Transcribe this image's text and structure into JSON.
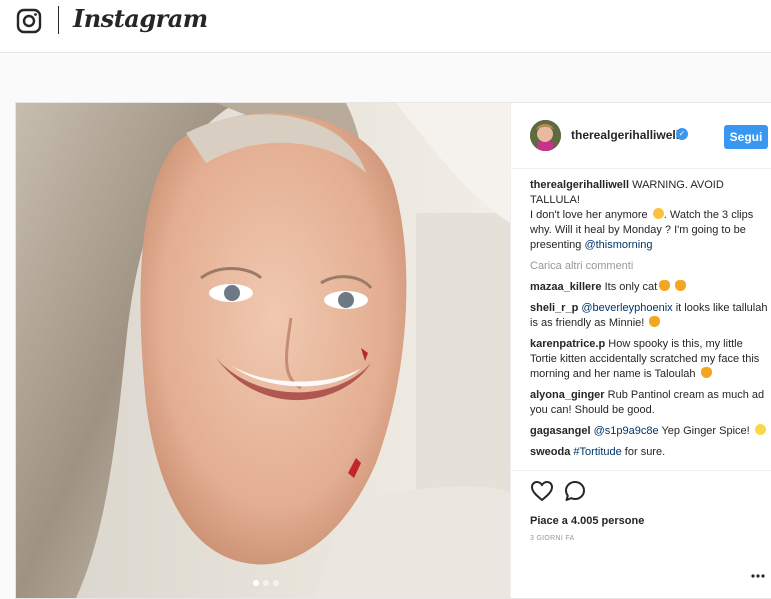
{
  "header": {
    "logo_text": "Instagram",
    "camera_icon": "instagram-camera-icon"
  },
  "post": {
    "author": "therealgerihalliwell",
    "verified_icon": "verified-badge-icon",
    "follow_label": "Segui",
    "caption": {
      "user": "therealgerihalliwell",
      "text_1": "WARNING. AVOID TALLULA!",
      "text_2": "I don't love her anymore",
      "text_3": ". Watch the 3 clips why. Will it heal by Monday ? I'm going to be presenting",
      "mention": "@thismorning"
    },
    "load_more": "Carica altri commenti",
    "comments": [
      {
        "user": "mazaa_killere",
        "text": "Its only cat",
        "mention": "",
        "after": ""
      },
      {
        "user": "sheli_r_p",
        "text": "",
        "mention": "@beverleyphoenix",
        "after": "it looks like tallulah is as friendly as Minnie!"
      },
      {
        "user": "karenpatrice.p",
        "text": "How spooky is this, my little Tortie kitten accidentally scratched my face this morning and her name is Taloulah",
        "mention": "",
        "after": ""
      },
      {
        "user": "alyona_ginger",
        "text": "Rub Pantinol cream as much ad you can! Should be good.",
        "mention": "",
        "after": ""
      },
      {
        "user": "gagasangel",
        "text": "",
        "mention": "@s1p9a9c8e",
        "after": "Yep Ginger Spice!"
      },
      {
        "user": "sweoda",
        "text": "",
        "mention": "#Tortitude",
        "after": "for sure."
      }
    ],
    "likes": "Piace a 4.005 persone",
    "time": "3 GIORNI FA",
    "carousel": {
      "count": 3,
      "active": 0
    },
    "colors": {
      "accent": "#3897f0",
      "link": "#003569",
      "muted": "#999999"
    }
  }
}
